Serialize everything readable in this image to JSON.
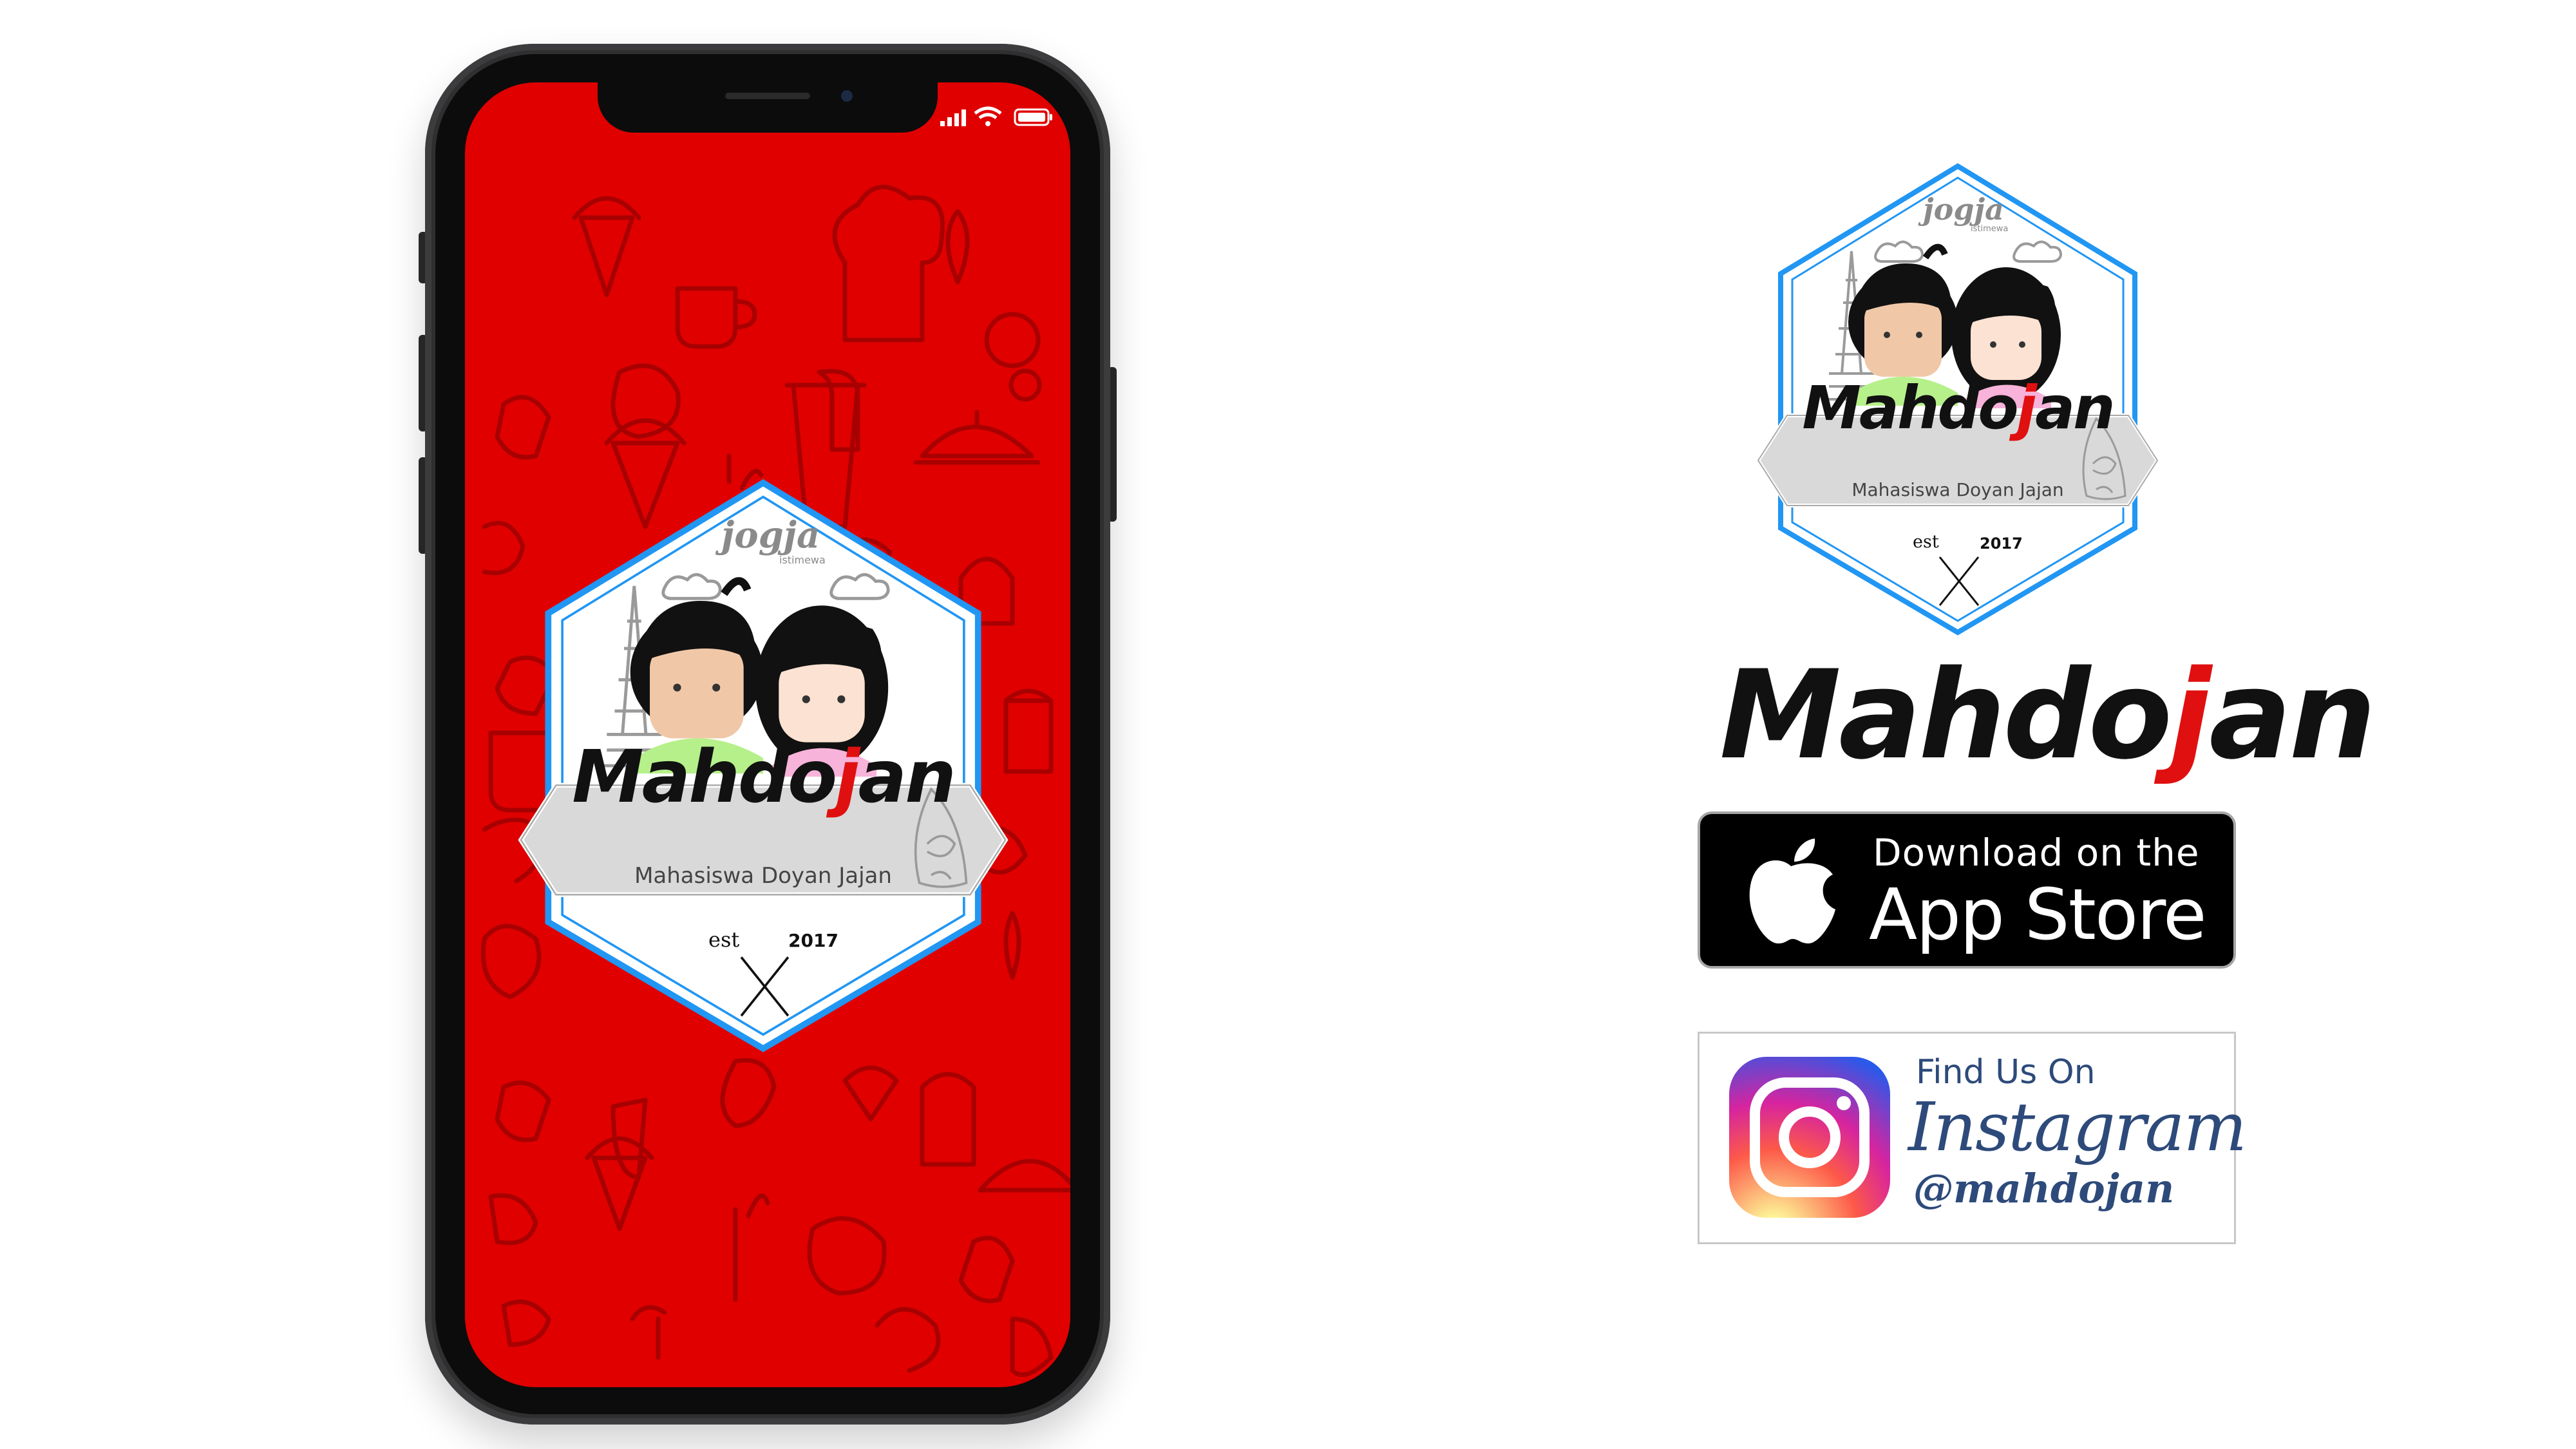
{
  "phone": {
    "status_icons": [
      "signal-bars-icon",
      "wifi-icon",
      "battery-icon"
    ],
    "screen_color": "#e00000",
    "badge": {
      "city": "jogja",
      "city_sub": "istimewa",
      "title_a": "Mahdo",
      "title_b": "j",
      "title_c": "an",
      "tagline": "Mahasiswa Doyan Jajan",
      "est": "est",
      "year": "2017"
    }
  },
  "logo_badge": {
    "city": "jogja",
    "city_sub": "istimewa",
    "title_a": "Mahdo",
    "title_b": "j",
    "title_c": "an",
    "tagline": "Mahasiswa Doyan Jajan",
    "est": "est",
    "year": "2017",
    "border_color": "#2196f3"
  },
  "brand": {
    "part_a": "Mahdo",
    "part_b": "j",
    "part_c": "an"
  },
  "app_store": {
    "line1": "Download on the",
    "line2": "App Store",
    "icon": "apple-icon"
  },
  "instagram": {
    "line1": "Find Us On",
    "line2": "Instagram",
    "handle": "@mahdojan",
    "icon": "instagram-icon"
  },
  "colors": {
    "accent_red": "#e01010",
    "badge_blue": "#2196f3",
    "banner_gray": "#d9d9d9"
  }
}
